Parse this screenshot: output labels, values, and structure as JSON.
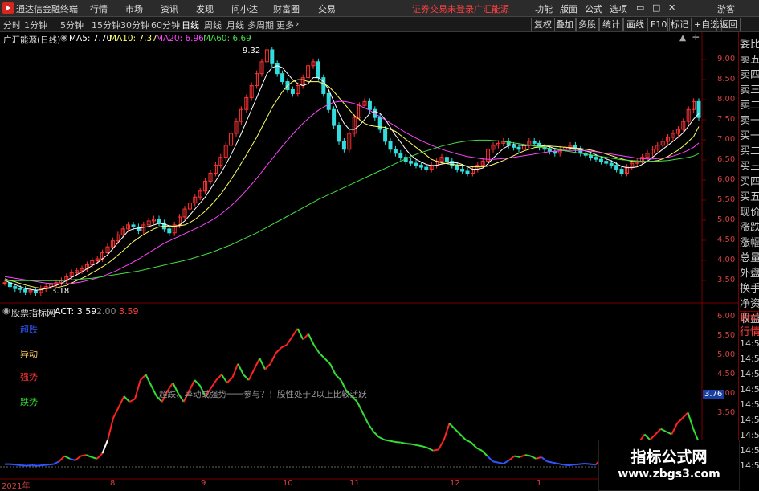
{
  "menubar": {
    "app_title": "通达信金融终端",
    "menus": [
      "行情",
      "市场",
      "资讯",
      "发现",
      "问小达",
      "财富圈",
      "交易"
    ],
    "notice": "证券交易未登录",
    "stock": "广汇能源",
    "right_menus": [
      "功能",
      "版面",
      "公式",
      "选项"
    ],
    "guest": "游客",
    "logo_icon": "tdx-logo-icon"
  },
  "toolbar": {
    "periods": [
      "分时",
      "1分钟",
      "5分钟",
      "15分钟",
      "30分钟",
      "60分钟",
      "日线",
      "周线",
      "月线",
      "多周期",
      "更多"
    ],
    "active_period": "日线",
    "right_buttons": [
      "复权",
      "叠加",
      "多股",
      "统计",
      "画线",
      "F10",
      "标记",
      "+自选",
      "返回"
    ]
  },
  "kline_info": {
    "title": "广汇能源(日线)",
    "ma5": "MA5: 7.70",
    "ma10": "MA10: 7.37",
    "ma20": "MA20: 6.96",
    "ma60": "MA60: 6.69"
  },
  "price_axis": [
    "9.00",
    "8.50",
    "8.00",
    "7.50",
    "7.00",
    "6.50",
    "6.00",
    "5.50",
    "5.00",
    "4.50",
    "4.00",
    "3.50"
  ],
  "annotations": {
    "high": "9.32",
    "low": "3.18"
  },
  "indicator": {
    "source": "股票指标网",
    "act": "ACT: 3.59",
    "v1": "2.00",
    "v2": "3.59",
    "legend": [
      "超跌",
      "异动",
      "强势",
      "跌势"
    ],
    "note": "超跌、异动或强势一一参与？！股性处于2以上比较活跃",
    "axis": [
      "6.00",
      "5.50",
      "5.00",
      "4.50",
      "4.00",
      "3.50"
    ],
    "current_tag": "3.76"
  },
  "x_axis": [
    "2021年",
    "8",
    "9",
    "10",
    "11",
    "12",
    "1"
  ],
  "side_panel": [
    "委比",
    "卖五",
    "卖四",
    "卖三",
    "卖二",
    "卖一",
    "买一",
    "买二",
    "买三",
    "买四",
    "买五",
    "现价",
    "涨跌",
    "涨幅",
    "总量",
    "外盘",
    "换手",
    "净资",
    "收益"
  ],
  "side_panel_lower": [
    "自动",
    "行情",
    "14:50",
    "14:50",
    "14:50",
    "14:50",
    "14:50",
    "14:50",
    "14:50",
    "14:50",
    "14:50"
  ],
  "watermark": {
    "title": "指标公式网",
    "url": "www.zbgs3.com"
  },
  "chart_data": {
    "type": "line",
    "title": "",
    "price_range": [
      3.0,
      9.4
    ],
    "close": [
      3.45,
      3.35,
      3.3,
      3.28,
      3.22,
      3.25,
      3.2,
      3.3,
      3.35,
      3.4,
      3.45,
      3.5,
      3.6,
      3.7,
      3.75,
      3.8,
      3.9,
      4.0,
      4.05,
      4.2,
      4.35,
      4.5,
      4.65,
      4.8,
      4.9,
      4.85,
      4.75,
      4.9,
      5.0,
      5.05,
      4.95,
      4.8,
      4.7,
      4.9,
      5.1,
      5.3,
      5.45,
      5.6,
      5.75,
      6.0,
      6.2,
      6.4,
      6.6,
      6.9,
      7.2,
      7.5,
      7.8,
      8.1,
      8.4,
      8.7,
      9.0,
      9.3,
      8.95,
      8.7,
      8.5,
      8.3,
      8.2,
      8.4,
      8.6,
      8.9,
      9.0,
      8.6,
      8.2,
      7.8,
      7.4,
      7.0,
      6.8,
      7.2,
      7.6,
      7.9,
      8.0,
      7.8,
      7.6,
      7.3,
      7.0,
      6.8,
      6.7,
      6.6,
      6.5,
      6.45,
      6.4,
      6.35,
      6.3,
      6.4,
      6.5,
      6.6,
      6.5,
      6.4,
      6.3,
      6.25,
      6.2,
      6.3,
      6.4,
      6.5,
      6.8,
      6.9,
      6.95,
      7.0,
      6.9,
      6.85,
      6.8,
      6.9,
      7.0,
      6.95,
      6.85,
      6.8,
      6.75,
      6.7,
      6.8,
      6.85,
      6.9,
      6.8,
      6.7,
      6.65,
      6.6,
      6.55,
      6.5,
      6.45,
      6.4,
      6.3,
      6.2,
      6.35,
      6.45,
      6.5,
      6.6,
      6.7,
      6.8,
      6.9,
      7.0,
      7.1,
      7.2,
      7.3,
      7.5,
      7.8,
      8.0,
      7.6
    ],
    "ma_series": [
      {
        "name": "MA5",
        "color": "#ffffff",
        "values": [
          3.5,
          3.45,
          3.4,
          3.35,
          3.3,
          3.28,
          3.26,
          3.27,
          3.3,
          3.34,
          3.38,
          3.43,
          3.5,
          3.58,
          3.65,
          3.72,
          3.8,
          3.88,
          3.95,
          4.05,
          4.15,
          4.3,
          4.45,
          4.6,
          4.75,
          4.8,
          4.82,
          4.84,
          4.86,
          4.9,
          4.94,
          4.92,
          4.88,
          4.86,
          4.9,
          5.0,
          5.15,
          5.3,
          5.45,
          5.6,
          5.8,
          6.0,
          6.2,
          6.42,
          6.66,
          6.92,
          7.2,
          7.5,
          7.8,
          8.1,
          8.4,
          8.7,
          8.85,
          8.9,
          8.85,
          8.7,
          8.55,
          8.45,
          8.4,
          8.45,
          8.6,
          8.6,
          8.5,
          8.3,
          8.0,
          7.7,
          7.45,
          7.3,
          7.3,
          7.4,
          7.55,
          7.7,
          7.75,
          7.7,
          7.55,
          7.35,
          7.15,
          6.98,
          6.8,
          6.65,
          6.55,
          6.48,
          6.42,
          6.39,
          6.4,
          6.43,
          6.45,
          6.47,
          6.46,
          6.42,
          6.36,
          6.3,
          6.3,
          6.33,
          6.44,
          6.58,
          6.7,
          6.82,
          6.89,
          6.92,
          6.9,
          6.89,
          6.9,
          6.9,
          6.9,
          6.88,
          6.86,
          6.82,
          6.8,
          6.8,
          6.82,
          6.81,
          6.79,
          6.76,
          6.72,
          6.66,
          6.61,
          6.56,
          6.51,
          6.44,
          6.37,
          6.34,
          6.34,
          6.36,
          6.42,
          6.5,
          6.6,
          6.7,
          6.8,
          6.9,
          7.0,
          7.1,
          7.22,
          7.38,
          7.56,
          7.7
        ]
      },
      {
        "name": "MA10",
        "color": "#ffff66",
        "values": [
          3.55,
          3.5,
          3.47,
          3.43,
          3.39,
          3.36,
          3.33,
          3.31,
          3.3,
          3.31,
          3.32,
          3.35,
          3.38,
          3.44,
          3.5,
          3.56,
          3.62,
          3.7,
          3.77,
          3.85,
          3.93,
          4.03,
          4.14,
          4.25,
          4.37,
          4.48,
          4.57,
          4.66,
          4.73,
          4.8,
          4.85,
          4.87,
          4.87,
          4.87,
          4.88,
          4.9,
          4.96,
          5.04,
          5.14,
          5.25,
          5.38,
          5.52,
          5.67,
          5.85,
          6.04,
          6.24,
          6.45,
          6.66,
          6.88,
          7.1,
          7.35,
          7.6,
          7.85,
          8.05,
          8.25,
          8.4,
          8.5,
          8.55,
          8.55,
          8.5,
          8.5,
          8.5,
          8.45,
          8.38,
          8.25,
          8.1,
          7.95,
          7.8,
          7.65,
          7.55,
          7.45,
          7.4,
          7.38,
          7.36,
          7.35,
          7.3,
          7.25,
          7.15,
          7.05,
          6.95,
          6.85,
          6.75,
          6.65,
          6.55,
          6.5,
          6.46,
          6.44,
          6.42,
          6.41,
          6.4,
          6.38,
          6.36,
          6.36,
          6.36,
          6.38,
          6.42,
          6.47,
          6.52,
          6.58,
          6.64,
          6.7,
          6.76,
          6.8,
          6.84,
          6.86,
          6.88,
          6.88,
          6.87,
          6.86,
          6.85,
          6.84,
          6.83,
          6.82,
          6.8,
          6.78,
          6.75,
          6.72,
          6.68,
          6.64,
          6.6,
          6.56,
          6.53,
          6.5,
          6.48,
          6.48,
          6.49,
          6.5,
          6.52,
          6.56,
          6.62,
          6.7,
          6.78,
          6.88,
          7.0,
          7.12,
          7.37
        ]
      },
      {
        "name": "MA20",
        "color": "#ff44ff",
        "values": [
          3.6,
          3.58,
          3.56,
          3.54,
          3.52,
          3.5,
          3.48,
          3.46,
          3.44,
          3.43,
          3.42,
          3.42,
          3.42,
          3.43,
          3.45,
          3.47,
          3.5,
          3.53,
          3.57,
          3.61,
          3.66,
          3.71,
          3.77,
          3.84,
          3.9,
          3.97,
          4.04,
          4.12,
          4.2,
          4.28,
          4.36,
          4.44,
          4.5,
          4.56,
          4.62,
          4.68,
          4.74,
          4.8,
          4.86,
          4.93,
          5.0,
          5.08,
          5.17,
          5.27,
          5.38,
          5.5,
          5.63,
          5.77,
          5.92,
          6.07,
          6.23,
          6.4,
          6.56,
          6.72,
          6.88,
          7.03,
          7.18,
          7.32,
          7.45,
          7.57,
          7.68,
          7.78,
          7.86,
          7.93,
          7.98,
          8.0,
          8.0,
          7.98,
          7.95,
          7.9,
          7.84,
          7.78,
          7.7,
          7.62,
          7.54,
          7.46,
          7.38,
          7.3,
          7.22,
          7.15,
          7.08,
          7.02,
          6.96,
          6.9,
          6.85,
          6.8,
          6.76,
          6.72,
          6.68,
          6.65,
          6.62,
          6.6,
          6.58,
          6.56,
          6.55,
          6.55,
          6.56,
          6.57,
          6.58,
          6.6,
          6.62,
          6.64,
          6.66,
          6.68,
          6.7,
          6.72,
          6.74,
          6.75,
          6.76,
          6.77,
          6.77,
          6.77,
          6.77,
          6.76,
          6.75,
          6.74,
          6.72,
          6.7,
          6.68,
          6.66,
          6.64,
          6.62,
          6.6,
          6.58,
          6.57,
          6.56,
          6.56,
          6.57,
          6.58,
          6.6,
          6.63,
          6.67,
          6.72,
          6.78,
          6.85,
          6.96
        ]
      },
      {
        "name": "MA60",
        "color": "#44dd44",
        "values": [
          3.5,
          3.5,
          3.5,
          3.5,
          3.5,
          3.5,
          3.5,
          3.5,
          3.5,
          3.5,
          3.5,
          3.5,
          3.51,
          3.52,
          3.53,
          3.54,
          3.55,
          3.56,
          3.58,
          3.6,
          3.62,
          3.64,
          3.66,
          3.68,
          3.7,
          3.72,
          3.74,
          3.77,
          3.8,
          3.83,
          3.86,
          3.89,
          3.92,
          3.95,
          3.98,
          4.01,
          4.04,
          4.08,
          4.12,
          4.16,
          4.2,
          4.25,
          4.3,
          4.35,
          4.4,
          4.46,
          4.52,
          4.58,
          4.64,
          4.7,
          4.77,
          4.84,
          4.91,
          4.98,
          5.05,
          5.12,
          5.19,
          5.26,
          5.33,
          5.4,
          5.47,
          5.54,
          5.6,
          5.66,
          5.72,
          5.78,
          5.84,
          5.9,
          5.96,
          6.02,
          6.08,
          6.14,
          6.2,
          6.26,
          6.32,
          6.38,
          6.44,
          6.5,
          6.56,
          6.62,
          6.67,
          6.72,
          6.76,
          6.8,
          6.84,
          6.88,
          6.91,
          6.94,
          6.97,
          6.99,
          7.01,
          7.02,
          7.03,
          7.03,
          7.03,
          7.02,
          7.01,
          7.0,
          6.98,
          6.96,
          6.94,
          6.92,
          6.9,
          6.88,
          6.86,
          6.84,
          6.82,
          6.8,
          6.78,
          6.76,
          6.74,
          6.72,
          6.7,
          6.68,
          6.66,
          6.64,
          6.62,
          6.6,
          6.58,
          6.56,
          6.54,
          6.53,
          6.52,
          6.51,
          6.5,
          6.5,
          6.5,
          6.5,
          6.51,
          6.52,
          6.54,
          6.56,
          6.58,
          6.6,
          6.63,
          6.69
        ]
      }
    ],
    "indicator_range": [
      3.3,
      6.1
    ],
    "act": [
      3.35,
      3.35,
      3.34,
      3.33,
      3.32,
      3.33,
      3.32,
      3.33,
      3.34,
      3.35,
      3.4,
      3.5,
      3.45,
      3.42,
      3.5,
      3.52,
      3.48,
      3.45,
      3.55,
      3.8,
      4.2,
      4.4,
      4.6,
      4.5,
      4.55,
      4.9,
      5.0,
      4.8,
      4.6,
      4.5,
      4.7,
      4.85,
      4.65,
      4.5,
      4.7,
      4.9,
      4.8,
      4.6,
      4.75,
      4.9,
      5.0,
      4.85,
      4.95,
      5.2,
      5.0,
      4.9,
      5.1,
      5.3,
      5.1,
      5.2,
      5.4,
      5.5,
      5.55,
      5.7,
      5.85,
      5.65,
      5.75,
      5.55,
      5.4,
      5.3,
      5.2,
      5.0,
      4.9,
      4.7,
      4.6,
      4.5,
      4.3,
      4.1,
      3.95,
      3.85,
      3.8,
      3.78,
      3.76,
      3.75,
      3.73,
      3.72,
      3.7,
      3.68,
      3.65,
      3.6,
      3.62,
      3.8,
      4.1,
      4.0,
      3.9,
      3.8,
      3.75,
      3.65,
      3.6,
      3.5,
      3.4,
      3.38,
      3.36,
      3.42,
      3.5,
      3.48,
      3.52,
      3.5,
      3.45,
      3.48,
      3.4,
      3.38,
      3.36,
      3.34,
      3.33,
      3.34,
      3.35,
      3.36,
      3.35,
      3.34,
      3.45,
      3.6,
      3.62,
      3.7,
      3.65,
      3.62,
      3.7,
      3.76,
      3.9,
      3.8,
      3.9,
      4.0,
      3.95,
      3.9,
      4.1,
      4.2,
      4.3,
      4.0,
      3.76
    ]
  }
}
